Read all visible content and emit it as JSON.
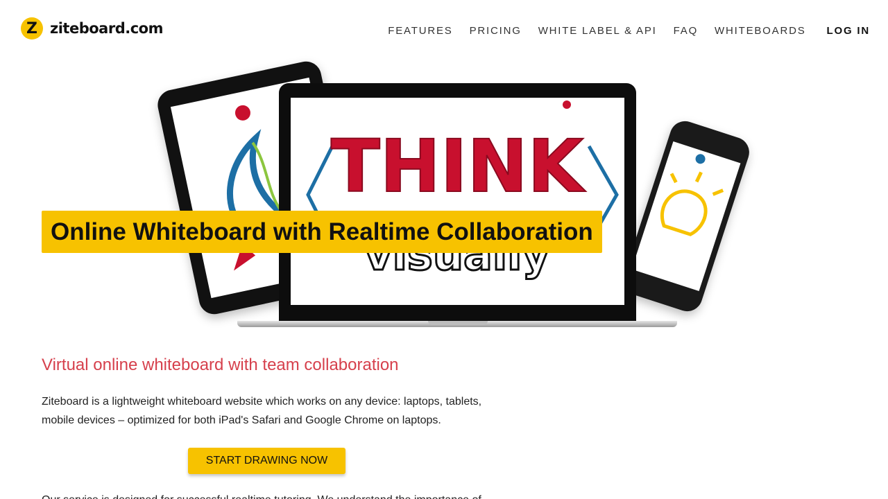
{
  "header": {
    "logo_badge": "Z",
    "logo_text": "ziteboard.com",
    "nav": {
      "features": "FEATURES",
      "pricing": "PRICING",
      "white_label": "WHITE LABEL & API",
      "faq": "FAQ",
      "whiteboards": "WHITEBOARDS",
      "login": "LOG IN"
    }
  },
  "hero": {
    "title": "Online Whiteboard with Realtime Collaboration",
    "illustration_text_top": "THINK",
    "illustration_text_bottom": "visually"
  },
  "main": {
    "subheading": "Virtual online whiteboard with team collaboration",
    "paragraph": "Ziteboard is a lightweight whiteboard website which works on any device: laptops, tablets, mobile devices – optimized for both iPad's Safari and Google Chrome on laptops.",
    "cta_label": "START DRAWING NOW",
    "paragraph2": "Our service is designed for successful realtime tutoring. We understand the importance of"
  },
  "colors": {
    "accent_yellow": "#f7c200",
    "subheading_red": "#d6404c",
    "illustration_red": "#c8102e",
    "illustration_blue": "#1d6fa5"
  }
}
